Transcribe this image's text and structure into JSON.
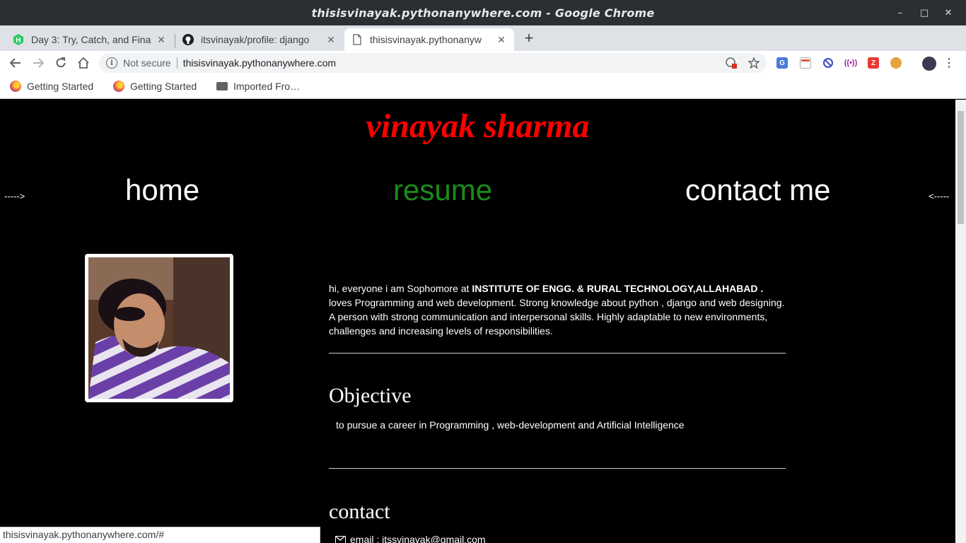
{
  "window": {
    "title": "thisisvinayak.pythonanywhere.com - Google Chrome",
    "minimize": "–",
    "maximize": "□",
    "close": "✕"
  },
  "tabs": [
    {
      "label": "Day 3: Try, Catch, and Fina",
      "favicon": "hackerrank-icon",
      "close": "✕"
    },
    {
      "label": "itsvinayak/profile: django",
      "favicon": "github-icon",
      "close": "✕"
    },
    {
      "label": "thisisvinayak.pythonanyw",
      "favicon": "page-icon",
      "close": "✕",
      "active": true
    }
  ],
  "new_tab": "+",
  "toolbar": {
    "security_label": "Not secure",
    "url": "thisisvinayak.pythonanywhere.com"
  },
  "bookmarks": [
    {
      "label": "Getting Started",
      "icon": "firefox-icon"
    },
    {
      "label": "Getting Started",
      "icon": "firefox-icon"
    },
    {
      "label": "Imported Fro…",
      "icon": "folder-icon"
    }
  ],
  "page": {
    "site_title": "vinayak sharma",
    "arrow_left": "----->",
    "arrow_right": "<-----",
    "nav": {
      "home": "home",
      "resume": "resume",
      "contact": "contact me",
      "active_color": "#1a8c1a"
    },
    "intro": {
      "prefix": "hi, everyone i am Sophomore at ",
      "institute": "INSTITUTE OF ENGG. & RURAL TECHNOLOGY,ALLAHABAD .",
      "body": " loves Programming and web development. Strong knowledge about python , django and web designing. A person with strong communication and interpersonal skills. Highly adaptable to new environments, challenges and increasing levels of responsibilities."
    },
    "objective_heading": "Objective",
    "objective_text": "to pursue a career in Programming , web-development and Artificial Intelligence",
    "contact_heading": "contact",
    "contact_email": "email : itssvinayak@gmail.com",
    "title_color": "#ff0000"
  },
  "statusbar": "thisisvinayak.pythonanywhere.com/#"
}
